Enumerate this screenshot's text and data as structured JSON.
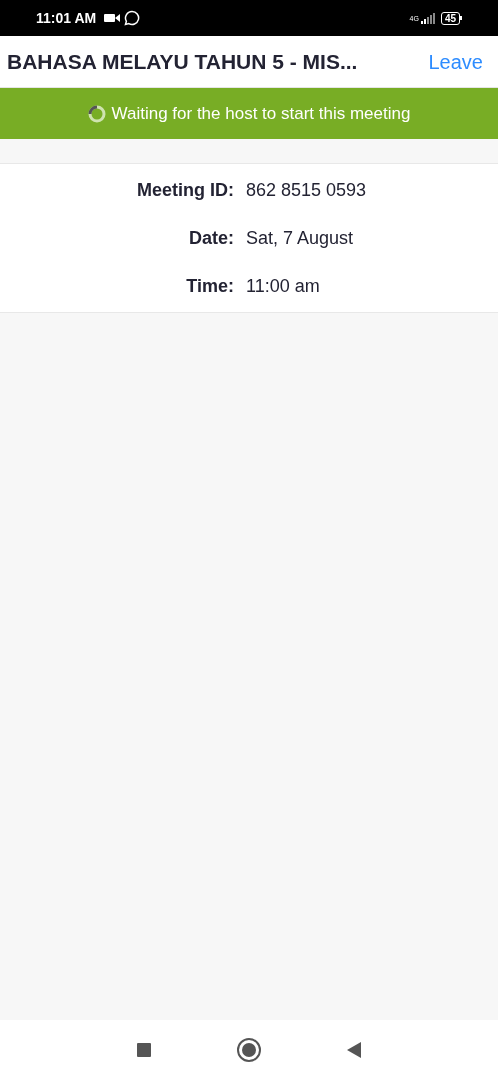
{
  "status_bar": {
    "time": "11:01 AM",
    "network": "4G",
    "battery": "45"
  },
  "header": {
    "title": "BAHASA MELAYU TAHUN 5 - MIS...",
    "leave": "Leave"
  },
  "banner": {
    "message": "Waiting for the host to start this meeting"
  },
  "details": [
    {
      "label": "Meeting ID:",
      "value": "862 8515 0593"
    },
    {
      "label": "Date:",
      "value": "Sat, 7 August"
    },
    {
      "label": "Time:",
      "value": "11:00 am"
    }
  ]
}
